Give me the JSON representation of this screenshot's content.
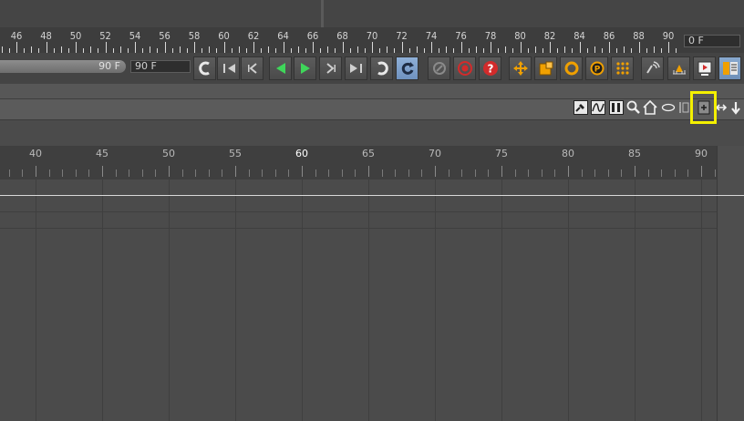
{
  "ruler": {
    "labels": [
      "46",
      "48",
      "50",
      "52",
      "54",
      "56",
      "58",
      "60",
      "62",
      "64",
      "66",
      "68",
      "70",
      "72",
      "74",
      "76",
      "78",
      "80",
      "82",
      "84",
      "86",
      "88",
      "90"
    ],
    "current_frame": "0 F"
  },
  "transport": {
    "end_slider_value": "90 F",
    "end_frame_value": "90 F",
    "buttons": [
      {
        "name": "undo-jump-icon"
      },
      {
        "name": "go-to-start-icon"
      },
      {
        "name": "previous-key-icon"
      },
      {
        "name": "play-backwards-icon"
      },
      {
        "name": "play-forward-icon"
      },
      {
        "name": "next-key-icon"
      },
      {
        "name": "go-to-end-icon"
      },
      {
        "name": "loop-icon"
      },
      {
        "name": "loop-active-icon"
      },
      {
        "name": "autokey-disabled-icon"
      },
      {
        "name": "record-keys-icon"
      },
      {
        "name": "help-icon"
      },
      {
        "name": "move-key-icon"
      },
      {
        "name": "scale-key-icon"
      },
      {
        "name": "rotate-key-icon"
      },
      {
        "name": "parameter-key-icon"
      },
      {
        "name": "pla-key-icon"
      },
      {
        "name": "sound-icon"
      },
      {
        "name": "motion-system-icon"
      },
      {
        "name": "render-preview-icon"
      },
      {
        "name": "timeline-icon"
      }
    ]
  },
  "panel_tools": [
    {
      "name": "key-mode-icon"
    },
    {
      "name": "fcurve-mode-icon"
    },
    {
      "name": "motion-mode-icon"
    },
    {
      "name": "zoom-icon"
    },
    {
      "name": "home-icon"
    },
    {
      "name": "frame-all-icon"
    },
    {
      "name": "frame-selected-icon"
    },
    {
      "name": "new-window-icon"
    },
    {
      "name": "pan-icon"
    },
    {
      "name": "scroll-down-icon"
    }
  ],
  "timeline": {
    "labels": [
      "40",
      "45",
      "50",
      "55",
      "60",
      "65",
      "70",
      "75",
      "80",
      "85",
      "90"
    ],
    "current_label": "60"
  },
  "colors": {
    "highlight": "#f4f000",
    "play_green": "#3fd65a",
    "record_red": "#d22b2b",
    "key_orange": "#f0a000",
    "active_blue": "#7a98bf"
  }
}
